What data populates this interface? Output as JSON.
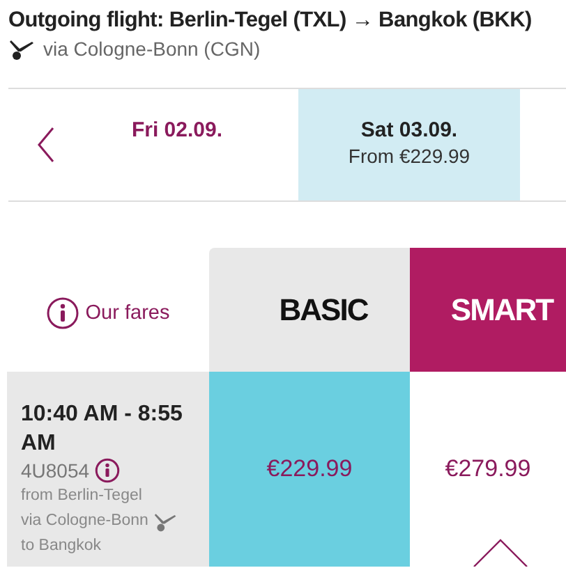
{
  "header": {
    "title": "Outgoing flight: Berlin-Tegel (TXL) → Bangkok (BKK)",
    "stopover": "via Cologne-Bonn (CGN)"
  },
  "dates": [
    {
      "label": "Fri 02.09.",
      "selected": false
    },
    {
      "label": "Sat 03.09.",
      "price": "From €229.99",
      "selected": true
    }
  ],
  "fares_link": "Our fares",
  "fares": [
    {
      "name": "BASIC",
      "selected": false
    },
    {
      "name": "SMART",
      "selected": true
    }
  ],
  "flight": {
    "times": "10:40 AM - 8:55 AM",
    "number": "4U8054",
    "from": "from Berlin-Tegel",
    "via": "via Cologne-Bonn",
    "to": "to Bangkok",
    "prices": [
      {
        "value": "€229.99",
        "selected": true
      },
      {
        "value": "€279.99",
        "selected": false
      }
    ]
  }
}
